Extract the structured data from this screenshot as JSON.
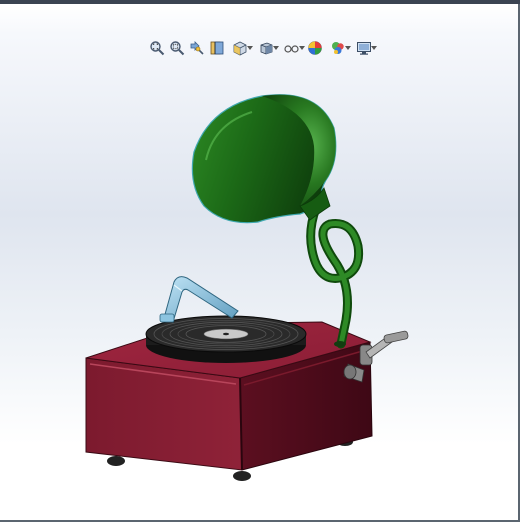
{
  "app": {
    "type": "cad-graphics-viewport",
    "model_description_visible": false
  },
  "heads_up_toolbar": {
    "tools": [
      {
        "id": "zoom-to-fit",
        "icon": "zoom-to-fit-icon",
        "has_dropdown": false
      },
      {
        "id": "zoom-to-area",
        "icon": "zoom-to-area-icon",
        "has_dropdown": false
      },
      {
        "id": "previous-view",
        "icon": "previous-view-icon",
        "has_dropdown": false
      },
      {
        "id": "section-view",
        "icon": "section-view-icon",
        "has_dropdown": false
      },
      {
        "id": "view-orientation",
        "icon": "view-orientation-icon",
        "has_dropdown": true
      },
      {
        "id": "display-style",
        "icon": "display-style-icon",
        "has_dropdown": true
      },
      {
        "id": "hide-show-items",
        "icon": "hide-show-items-icon",
        "has_dropdown": true
      },
      {
        "id": "edit-appearance",
        "icon": "edit-appearance-icon",
        "has_dropdown": false
      },
      {
        "id": "apply-scene",
        "icon": "apply-scene-icon",
        "has_dropdown": true
      },
      {
        "id": "view-settings",
        "icon": "view-settings-icon",
        "has_dropdown": true
      }
    ]
  },
  "model": {
    "name": "gramophone",
    "colors": {
      "cabinet": "#8b1e33",
      "horn": "#1f6e1a",
      "tonearm": "#7fb8d8",
      "record": "#2a2a2a",
      "crank": "#9a9a9a"
    }
  }
}
